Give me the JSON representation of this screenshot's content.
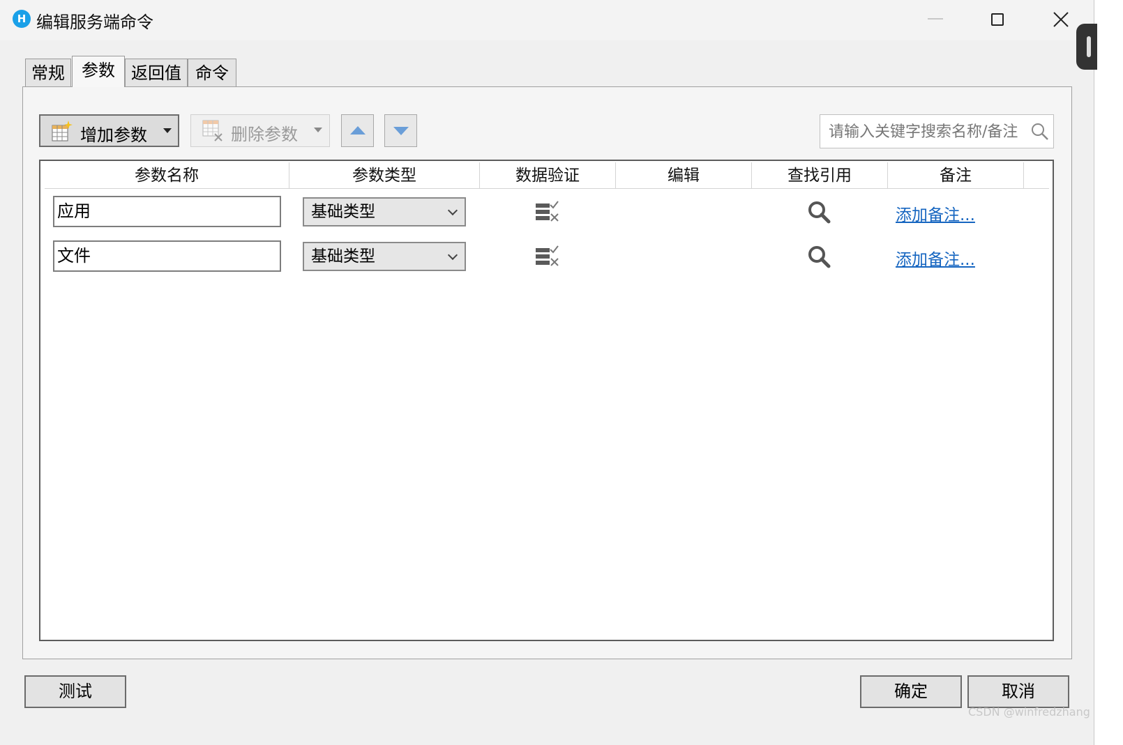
{
  "window": {
    "title": "编辑服务端命令",
    "icon": "H"
  },
  "tabs": [
    {
      "label": "常规"
    },
    {
      "label": "参数"
    },
    {
      "label": "返回值"
    },
    {
      "label": "命令"
    }
  ],
  "toolbar": {
    "add_label": "增加参数",
    "delete_label": "删除参数",
    "search_placeholder": "请输入关键字搜索名称/备注"
  },
  "grid": {
    "columns": [
      "参数名称",
      "参数类型",
      "数据验证",
      "编辑",
      "查找引用",
      "备注"
    ],
    "rows": [
      {
        "name": "应用",
        "type": "基础类型",
        "note_link": "添加备注..."
      },
      {
        "name": "文件",
        "type": "基础类型",
        "note_link": "添加备注..."
      }
    ]
  },
  "footer": {
    "test_label": "测试",
    "ok_label": "确定",
    "cancel_label": "取消"
  },
  "watermark": "CSDN @winfredzhang",
  "colors": {
    "accent_icon": "#1aa0e8",
    "link": "#1565c0",
    "arrow": "#6a9ed8"
  }
}
